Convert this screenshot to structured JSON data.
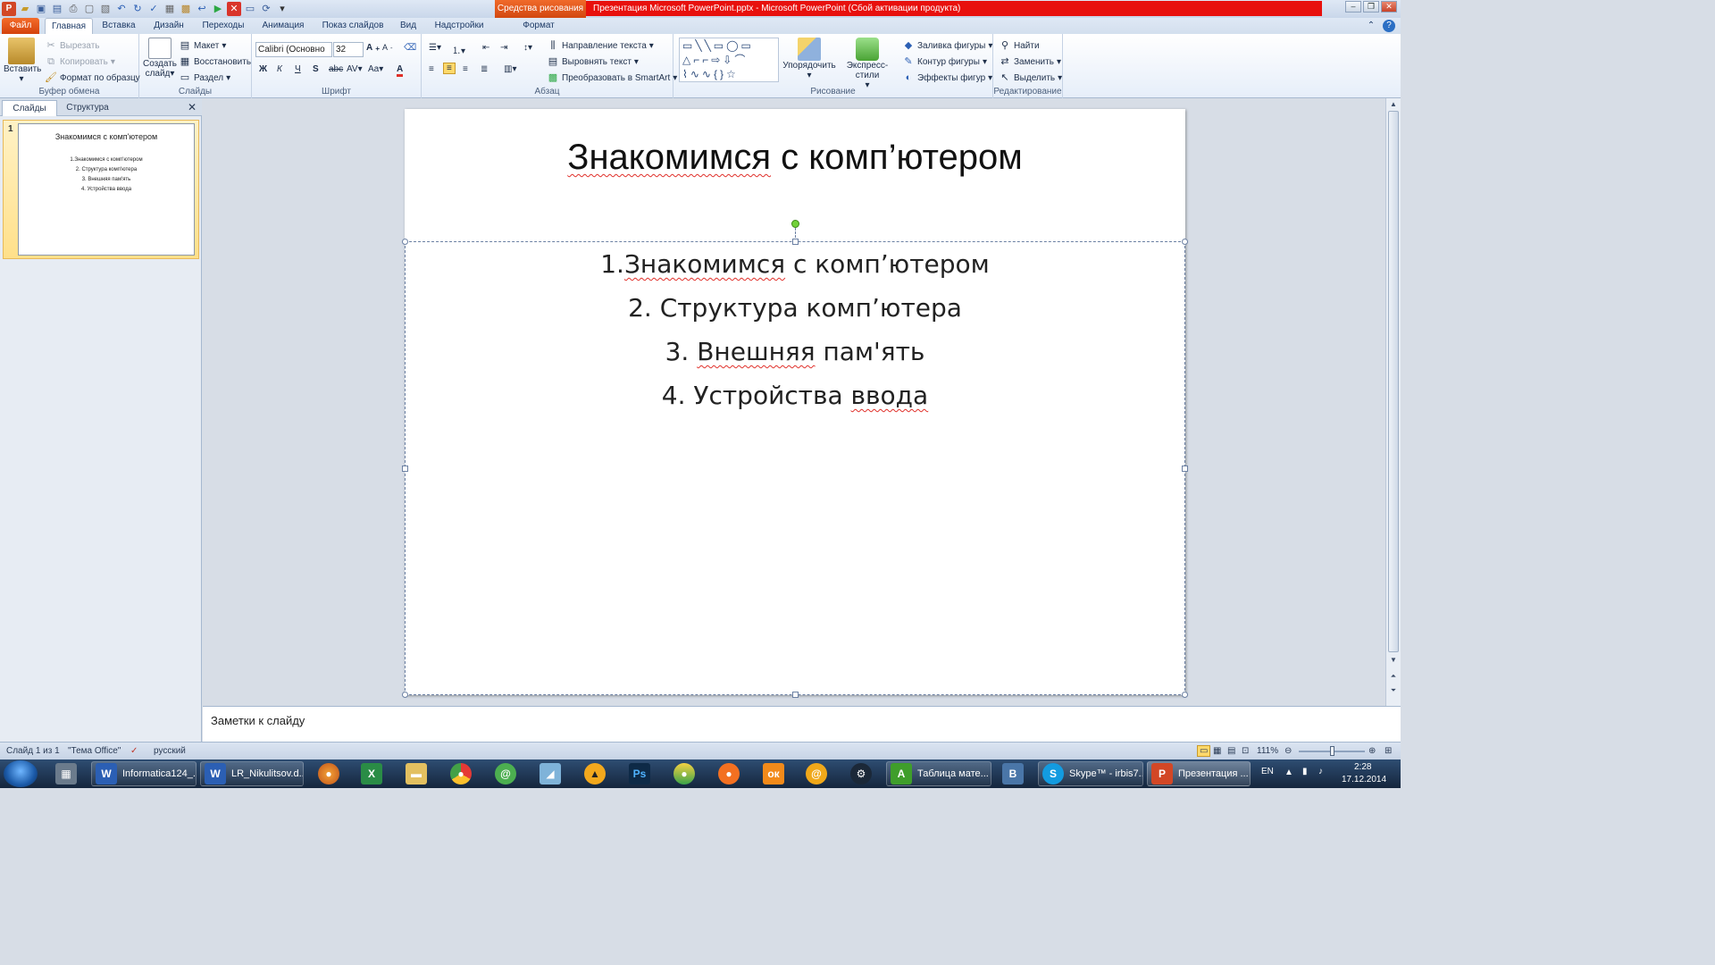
{
  "window": {
    "context_tab": "Средства рисования",
    "title": "Презентация Microsoft PowerPoint.pptx  -  Microsoft PowerPoint (Сбой активации продукта)"
  },
  "tabs": [
    "Файл",
    "Главная",
    "Вставка",
    "Дизайн",
    "Переходы",
    "Анимация",
    "Показ слайдов",
    "Вид",
    "Надстройки",
    "Формат"
  ],
  "ribbon": {
    "clipboard": {
      "label": "Буфер обмена",
      "paste": "Вставить",
      "cut": "Вырезать",
      "copy": "Копировать",
      "format_painter": "Формат по образцу"
    },
    "slides": {
      "label": "Слайды",
      "new_slide_line1": "Создать",
      "new_slide_line2": "слайд",
      "layout": "Макет",
      "reset": "Восстановить",
      "section": "Раздел"
    },
    "font": {
      "label": "Шрифт",
      "font_name": "Calibri (Основно",
      "font_size": "32"
    },
    "paragraph": {
      "label": "Абзац",
      "text_direction": "Направление текста",
      "align_text": "Выровнять текст",
      "smartart": "Преобразовать в SmartArt"
    },
    "drawing": {
      "label": "Рисование",
      "arrange": "Упорядочить",
      "quick_styles": "Экспресс-стили",
      "shape_fill": "Заливка фигуры",
      "shape_outline": "Контур фигуры",
      "shape_effects": "Эффекты фигур"
    },
    "editing": {
      "label": "Редактирование",
      "find": "Найти",
      "replace": "Заменить",
      "select": "Выделить"
    }
  },
  "left_panel": {
    "tabs": [
      "Слайды",
      "Структура"
    ],
    "thumbnail": {
      "number": "1",
      "title": "Знакомимся с комп'ютером",
      "lines": [
        "1.Знакомимся  с комп'ютером",
        "2. Структура  комп'ютера",
        "3. Внешняя  пам'ять",
        "4. Устройства  ввода"
      ]
    }
  },
  "slide": {
    "title_pre": "Знакомимся",
    "title_post": " с комп’ютером",
    "bullets": [
      {
        "num": "1.",
        "squig": "Знакомимся",
        "rest": " с комп’ютером"
      },
      {
        "num": "2. ",
        "squig": "",
        "rest": "Структура комп’ютера"
      },
      {
        "num": "3. ",
        "squig": "Внешняя",
        "rest": " пам'ять"
      },
      {
        "num": "4. ",
        "squig": "",
        "rest": "Устройства ",
        "squig2": "ввода"
      }
    ]
  },
  "notes": {
    "placeholder": "Заметки к слайду"
  },
  "status": {
    "slide_info": "Слайд 1 из 1",
    "theme": "\"Тема Office\"",
    "language": "русский",
    "zoom": "111%"
  },
  "taskbar": {
    "items": [
      {
        "label": "Informatica124_...",
        "icon": "W",
        "color": "#2b5fb4"
      },
      {
        "label": "LR_Nikulitsov.d...",
        "icon": "W",
        "color": "#2b5fb4"
      },
      {
        "label": "Таблица мате...",
        "icon": "A",
        "color": "#3f9e2b"
      },
      {
        "label": "Skype™ - irbis7...",
        "icon": "S",
        "color": "#139be0"
      },
      {
        "label": "Презентация ...",
        "icon": "P",
        "color": "#d24726"
      }
    ],
    "tray": {
      "lang": "EN",
      "time": "2:28",
      "date": "17.12.2014"
    }
  },
  "colors": {
    "accent_red": "#e8100d",
    "context_orange": "#d24710",
    "file_tab": "#d4420c",
    "selected_thumb": "#ffe08a",
    "rotation_handle": "#72d13a"
  }
}
